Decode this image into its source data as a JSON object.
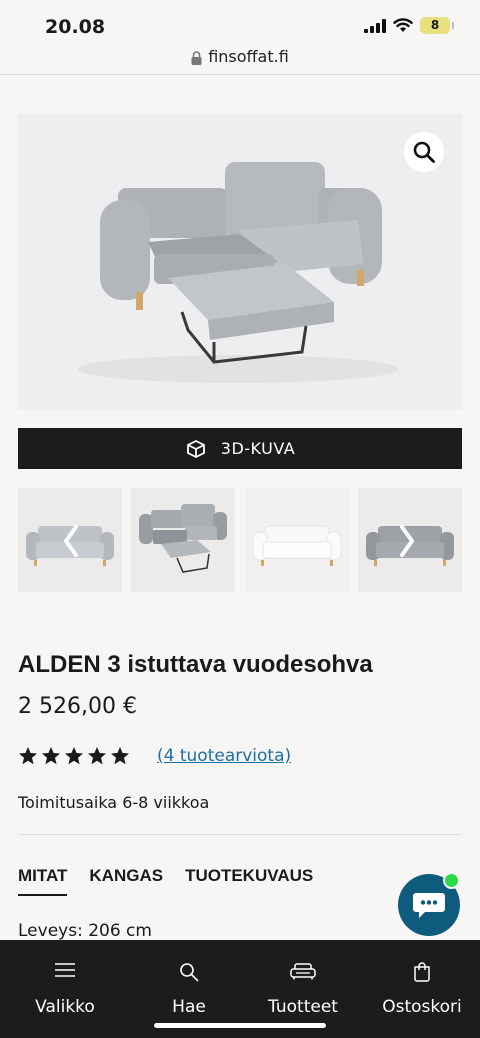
{
  "status": {
    "time": "20.08",
    "battery": "8"
  },
  "browser": {
    "url": "finsoffat.fi"
  },
  "gallery": {
    "zoom_icon": "magnifier-icon",
    "button_3d_label": "3D-KUVA",
    "button_3d_icon": "cube-icon"
  },
  "product": {
    "title": "ALDEN 3 istuttava vuodesohva",
    "price": "2 526,00 €",
    "rating": 5,
    "rating_max": 5,
    "reviews_link": "(4 tuotearviota)",
    "delivery": "Toimitusaika 6-8 viikkoa"
  },
  "tabs": [
    {
      "label": "MITAT",
      "active": true
    },
    {
      "label": "KANGAS",
      "active": false
    },
    {
      "label": "TUOTEKUVAUS",
      "active": false
    }
  ],
  "spec": {
    "width": "Leveys: 206 cm"
  },
  "bottom_nav": [
    {
      "label": "Valikko",
      "icon": "menu-icon"
    },
    {
      "label": "Hae",
      "icon": "search-icon"
    },
    {
      "label": "Tuotteet",
      "icon": "sofa-icon"
    },
    {
      "label": "Ostoskori",
      "icon": "shopping-bag-icon"
    }
  ],
  "colors": {
    "accent_link": "#1d6fa4",
    "dark": "#1c1c1e",
    "chat": "#0f5b7e",
    "online": "#2bd94a"
  }
}
